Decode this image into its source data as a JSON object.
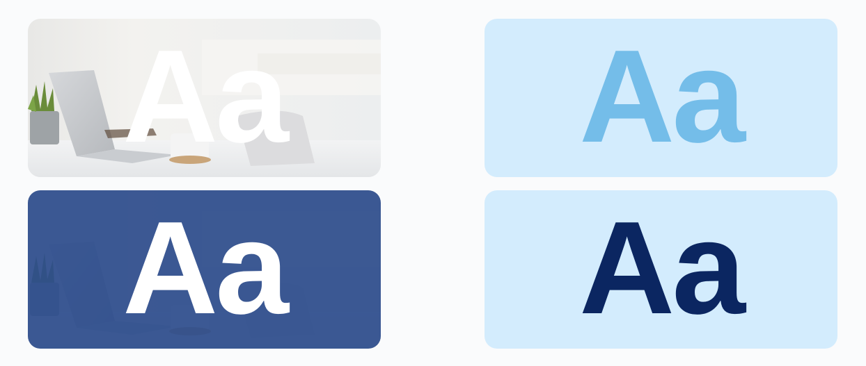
{
  "colors": {
    "page_background": "#fafbfc",
    "light_card_background": "#d3ecfd",
    "dark_overlay": "#2d4c8c",
    "dark_overlay_opacity": 0.93,
    "white_text": "#ffffff",
    "light_blue_text": "#74bde9",
    "navy_text": "#0b2661"
  },
  "samples": [
    {
      "text": "Aa",
      "style": "white text over desk photo"
    },
    {
      "text": "Aa",
      "style": "light blue text on light blue"
    },
    {
      "text": "Aa",
      "style": "white text over navy-tinted desk photo"
    },
    {
      "text": "Aa",
      "style": "navy text on light blue"
    }
  ]
}
